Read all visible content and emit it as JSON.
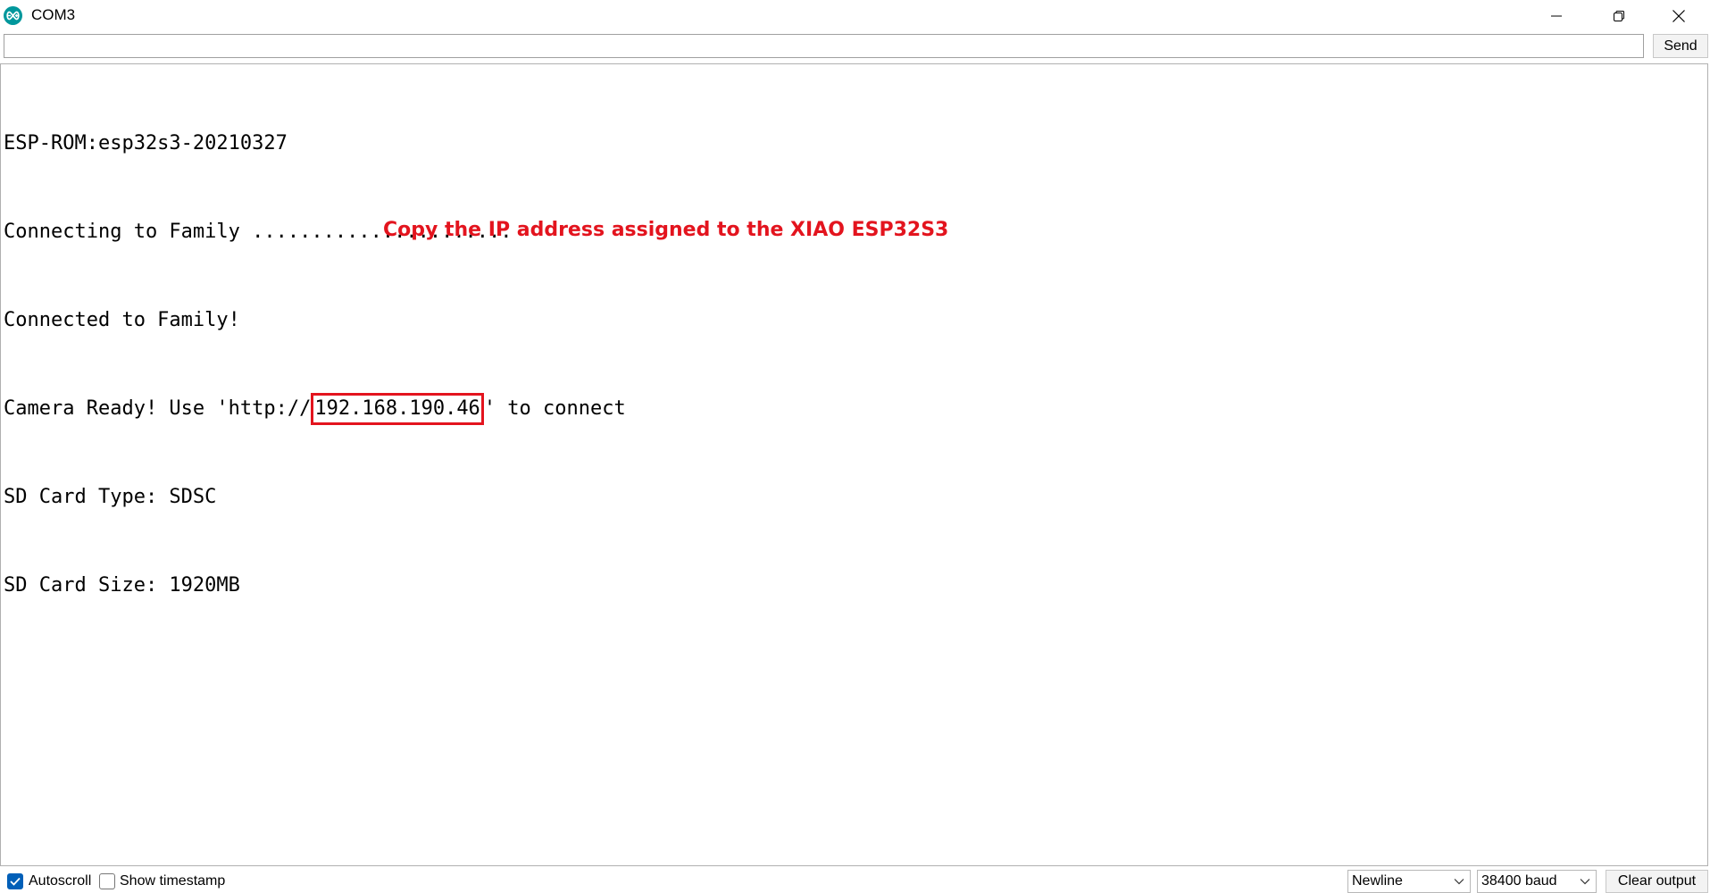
{
  "window": {
    "title": "COM3",
    "app_icon": "arduino-icon"
  },
  "send_bar": {
    "input_value": "",
    "send_label": "Send"
  },
  "output": {
    "lines": [
      "ESP-ROM:esp32s3-20210327",
      "Connecting to Family ......................",
      "Connected to Family!",
      "Camera Ready! Use 'http://",
      "SD Card Type: SDSC",
      "SD Card Size: 1920MB"
    ],
    "camera_line": {
      "prefix": "Camera Ready! Use 'http://",
      "ip": "192.168.190.46",
      "suffix": "' to connect"
    },
    "annotation": "Copy the IP address assigned to the XIAO ESP32S3",
    "highlight_color": "#e3141e"
  },
  "bottom_bar": {
    "autoscroll_label": "Autoscroll",
    "autoscroll_checked": true,
    "timestamp_label": "Show timestamp",
    "timestamp_checked": false,
    "line_ending": "Newline",
    "baud_rate": "38400 baud",
    "clear_label": "Clear output",
    "accent_color": "#005fb8"
  }
}
